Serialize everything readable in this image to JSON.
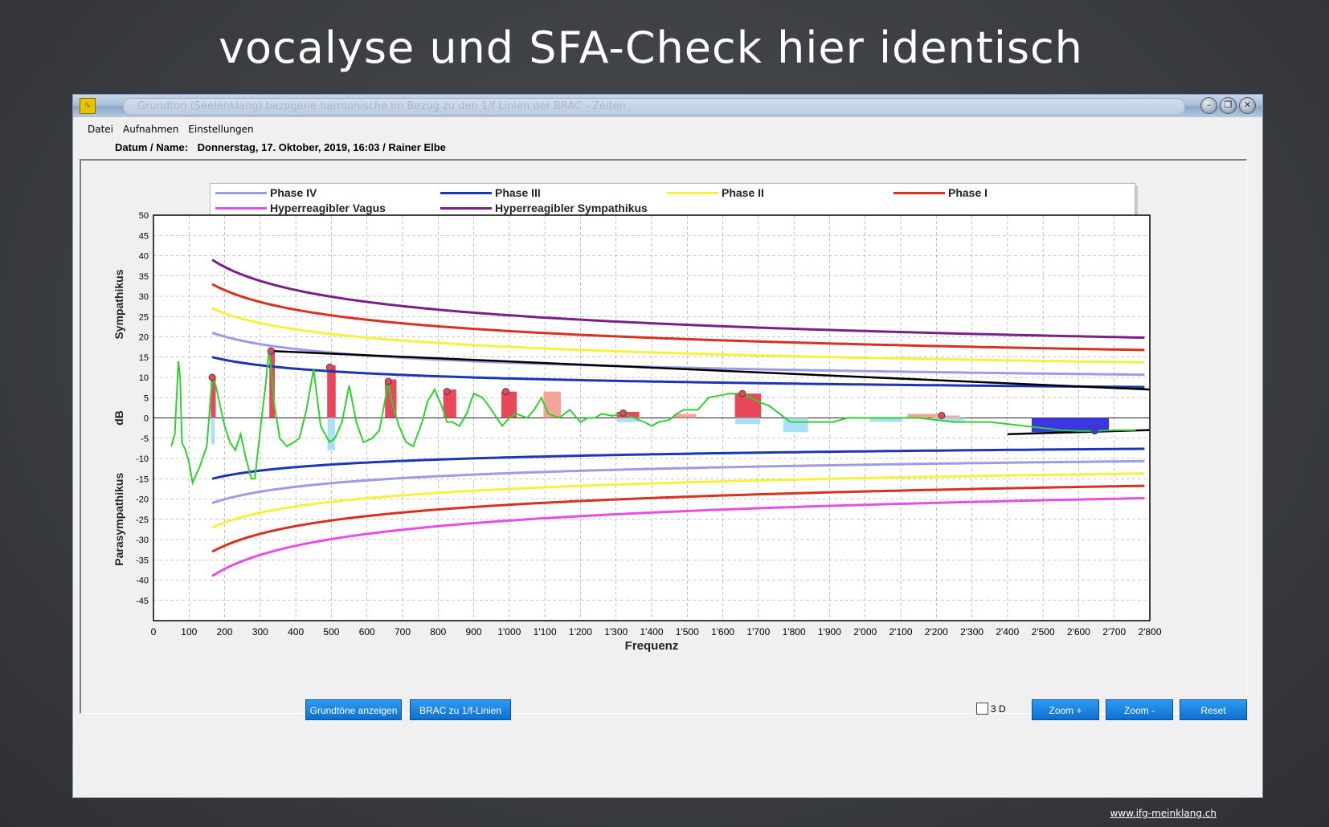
{
  "slide": {
    "title": "vocalyse und SFA-Check hier identisch",
    "footer_link": "www.ifg-meinklang.ch"
  },
  "window": {
    "title": "Grundton (Seelenklang) bezogene harmonische im Bezug zu den 1/f Linien der BRAC - Zeiten",
    "icon": "waveform-app-icon",
    "controls": [
      "minimize-icon",
      "restore-icon",
      "close-icon"
    ]
  },
  "menu": {
    "items": [
      "Datei",
      "Aufnahmen",
      "Einstellungen"
    ]
  },
  "header": {
    "label": "Datum / Name:",
    "value": "Donnerstag, 17. Oktober, 2019, 16:03  /  Rainer Elbe"
  },
  "buttons": {
    "grundtone": "Grundtöne anzeigen",
    "brac": "BRAC zu 1/f-Linien",
    "zoom_in": "Zoom +",
    "zoom_out": "Zoom -",
    "reset": "Reset",
    "threed_label": "3 D",
    "threed_checked": false
  },
  "chart_data": {
    "type": "line",
    "xlabel": "Frequenz",
    "ylabel": "dB",
    "ylabel_top": "Sympathikus",
    "ylabel_bottom": "Parasympathikus",
    "xlim": [
      0,
      2800
    ],
    "ylim": [
      -50,
      50
    ],
    "grid": true,
    "legend_position": "top",
    "x_ticks": [
      0,
      100,
      200,
      300,
      400,
      500,
      600,
      700,
      800,
      900,
      1000,
      1100,
      1200,
      1300,
      1400,
      1500,
      1600,
      1700,
      1800,
      1900,
      2000,
      2100,
      2200,
      2300,
      2400,
      2500,
      2600,
      2700,
      2800
    ],
    "x_tick_labels": [
      "0",
      "100",
      "200",
      "300",
      "400",
      "500",
      "600",
      "700",
      "800",
      "900",
      "1'000",
      "1'100",
      "1'200",
      "1'300",
      "1'400",
      "1'500",
      "1'600",
      "1'700",
      "1'800",
      "1'900",
      "2'000",
      "2'100",
      "2'200",
      "2'300",
      "2'400",
      "2'500",
      "2'600",
      "2'700",
      "2'800"
    ],
    "y_ticks": [
      50,
      45,
      40,
      35,
      30,
      25,
      20,
      15,
      10,
      5,
      0,
      -5,
      -10,
      -15,
      -20,
      -25,
      -30,
      -35,
      -40,
      -45
    ],
    "legend": [
      {
        "name": "Phase IV",
        "color": "#9b9be8"
      },
      {
        "name": "Phase III",
        "color": "#1c34b8"
      },
      {
        "name": "Phase II",
        "color": "#f7f13a"
      },
      {
        "name": "Phase I",
        "color": "#d9311f"
      },
      {
        "name": "Hyperreagibler Vagus",
        "color": "#e64ee6"
      },
      {
        "name": "Hyperreagibler Sympathikus",
        "color": "#7a1f88"
      }
    ],
    "curves": [
      {
        "name": "Hyperreagibler Sympathikus",
        "color": "#7a1f88",
        "amplitude": 39,
        "sign": 1
      },
      {
        "name": "Phase I",
        "color": "#d9311f",
        "amplitude": 33,
        "sign": 1
      },
      {
        "name": "Phase II",
        "color": "#f7f13a",
        "amplitude": 27,
        "sign": 1
      },
      {
        "name": "Phase IV",
        "color": "#9b9be8",
        "amplitude": 21,
        "sign": 1
      },
      {
        "name": "Phase III",
        "color": "#1c34b8",
        "amplitude": 15,
        "sign": 1
      },
      {
        "name": "Phase III",
        "color": "#1c34b8",
        "amplitude": 15,
        "sign": -1
      },
      {
        "name": "Phase IV",
        "color": "#9b9be8",
        "amplitude": 21,
        "sign": -1
      },
      {
        "name": "Phase II",
        "color": "#f7f13a",
        "amplitude": 27,
        "sign": -1
      },
      {
        "name": "Phase I",
        "color": "#d9311f",
        "amplitude": 33,
        "sign": -1
      },
      {
        "name": "Hyperreagibler Vagus",
        "color": "#e64ee6",
        "amplitude": 39,
        "sign": -1
      }
    ],
    "curve_x_start": 165,
    "black_line": {
      "x": [
        330,
        2800
      ],
      "y": [
        16.5,
        7
      ],
      "x2": [
        2400,
        2800
      ],
      "y2": [
        -4,
        -3
      ]
    },
    "bars": [
      {
        "x": 165,
        "width": 20,
        "value": 10,
        "color": "#e8485a"
      },
      {
        "x": 165,
        "width": 14,
        "value": -6.5,
        "color": "#a9e0f5"
      },
      {
        "x": 330,
        "width": 22,
        "value": 17,
        "color": "#e8485a"
      },
      {
        "x": 495,
        "width": 34,
        "value": 13,
        "color": "#e8485a"
      },
      {
        "x": 495,
        "width": 30,
        "value": -8,
        "color": "#a9e0f5"
      },
      {
        "x": 660,
        "width": 46,
        "value": 9.5,
        "color": "#e8485a"
      },
      {
        "x": 825,
        "width": 52,
        "value": 7,
        "color": "#e8485a"
      },
      {
        "x": 990,
        "width": 62,
        "value": 6.5,
        "color": "#e8485a"
      },
      {
        "x": 1110,
        "width": 70,
        "value": 6.5,
        "color": "#f4a59a"
      },
      {
        "x": 1320,
        "width": 90,
        "value": 1.5,
        "color": "#e8485a"
      },
      {
        "x": 1320,
        "width": 90,
        "value": -1,
        "color": "#a9e0f5"
      },
      {
        "x": 1480,
        "width": 90,
        "value": 1,
        "color": "#f4a59a"
      },
      {
        "x": 1655,
        "width": 105,
        "value": 6,
        "color": "#e8485a"
      },
      {
        "x": 1655,
        "width": 100,
        "value": -1.5,
        "color": "#a9e0f5"
      },
      {
        "x": 1790,
        "width": 100,
        "value": -3.5,
        "color": "#a9e0f5"
      },
      {
        "x": 2040,
        "width": 130,
        "value": -1,
        "color": "#a9e0f5"
      },
      {
        "x": 2145,
        "width": 130,
        "value": 1,
        "color": "#f4a59a"
      },
      {
        "x": 2215,
        "width": 130,
        "value": -0.8,
        "color": "#a9e0f5"
      },
      {
        "x": 2205,
        "width": 120,
        "value": 0.6,
        "color": "#f4a59a"
      },
      {
        "x": 2530,
        "width": 310,
        "value": -3.5,
        "color": "#3a36e0"
      }
    ],
    "markers": [
      {
        "x": 165,
        "y": 10,
        "color": "#e8485a"
      },
      {
        "x": 330,
        "y": 16.5,
        "color": "#e8485a"
      },
      {
        "x": 495,
        "y": 12.5,
        "color": "#e8485a"
      },
      {
        "x": 660,
        "y": 9,
        "color": "#e8485a"
      },
      {
        "x": 825,
        "y": 6.5,
        "color": "#e8485a"
      },
      {
        "x": 990,
        "y": 6.5,
        "color": "#e8485a"
      },
      {
        "x": 1320,
        "y": 1.2,
        "color": "#e8485a"
      },
      {
        "x": 1655,
        "y": 6,
        "color": "#e8485a"
      },
      {
        "x": 2215,
        "y": 0.6,
        "color": "#e8485a"
      },
      {
        "x": 2645,
        "y": -3.2,
        "color": "#3a36e0"
      }
    ],
    "green_series": {
      "name": "Spektrum",
      "color": "#2fd12f",
      "x": [
        50,
        60,
        70,
        75,
        80,
        90,
        100,
        110,
        120,
        130,
        150,
        165,
        175,
        185,
        200,
        215,
        230,
        245,
        260,
        275,
        285,
        300,
        315,
        325,
        330,
        340,
        355,
        375,
        395,
        410,
        430,
        450,
        470,
        495,
        510,
        530,
        550,
        570,
        590,
        615,
        635,
        650,
        660,
        670,
        690,
        710,
        730,
        755,
        770,
        790,
        810,
        825,
        840,
        860,
        880,
        900,
        925,
        950,
        980,
        1000,
        1020,
        1050,
        1070,
        1090,
        1110,
        1140,
        1170,
        1200,
        1220,
        1240,
        1260,
        1290,
        1320,
        1350,
        1380,
        1400,
        1420,
        1450,
        1470,
        1490,
        1530,
        1560,
        1590,
        1620,
        1655,
        1680,
        1700,
        1730,
        1760,
        1790,
        1820,
        1850,
        1880,
        1910,
        1950,
        1990,
        2050,
        2100,
        2150,
        2200,
        2250,
        2300,
        2350,
        2400,
        2450,
        2500,
        2550,
        2600,
        2645,
        2700,
        2760
      ],
      "y": [
        -7,
        -4,
        14,
        10,
        -6,
        -8,
        -11,
        -16,
        -14,
        -12,
        -7,
        10,
        8,
        4,
        -2,
        -6,
        -8,
        -4,
        -10,
        -15,
        -15,
        -3,
        8,
        17,
        13,
        3,
        -5,
        -7,
        -6,
        -5,
        2,
        12,
        -2,
        -6,
        -5,
        -1,
        8,
        -1,
        -6,
        -5,
        -3,
        4,
        9,
        4,
        -2,
        -6,
        -7,
        -1,
        4,
        7,
        3,
        -1,
        -1,
        -2,
        1,
        6,
        5,
        2,
        -2,
        0,
        1,
        0,
        2,
        5,
        1,
        0,
        2,
        -1,
        0,
        0,
        1,
        0.5,
        1,
        0,
        -1,
        -2,
        -1,
        -0.5,
        1,
        2,
        2,
        5,
        5.5,
        6,
        6,
        5,
        4,
        3,
        1,
        -1,
        -1,
        -1,
        -1,
        -1,
        0,
        0,
        0,
        0,
        0,
        -0.5,
        -1,
        -1,
        -1,
        -1.5,
        -2,
        -2.5,
        -3,
        -3.2,
        -3.2,
        -3,
        -3
      ]
    }
  }
}
